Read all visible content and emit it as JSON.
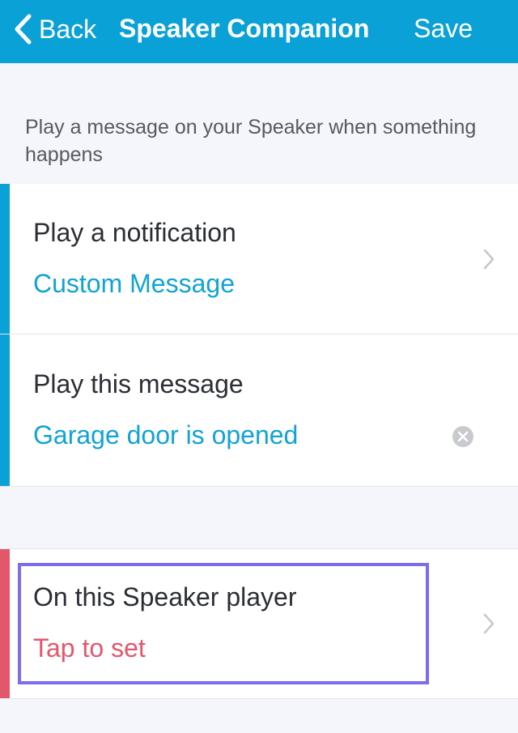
{
  "colors": {
    "nav_bar": "#0aa1d6",
    "accent_blue": "#0aa1d6",
    "accent_red": "#e3576b",
    "value_blue": "#12a3d4",
    "value_red": "#e3576b",
    "highlight": "#7b6cf0"
  },
  "nav": {
    "back_label": "Back",
    "title": "Speaker Companion",
    "save_label": "Save"
  },
  "description": "Play a message on your Speaker when something happens",
  "rows": {
    "notification": {
      "label": "Play a notification",
      "value": "Custom Message"
    },
    "message": {
      "label": "Play this message",
      "value": "Garage door is opened"
    },
    "player": {
      "label": "On this Speaker player",
      "value": "Tap to set"
    }
  }
}
